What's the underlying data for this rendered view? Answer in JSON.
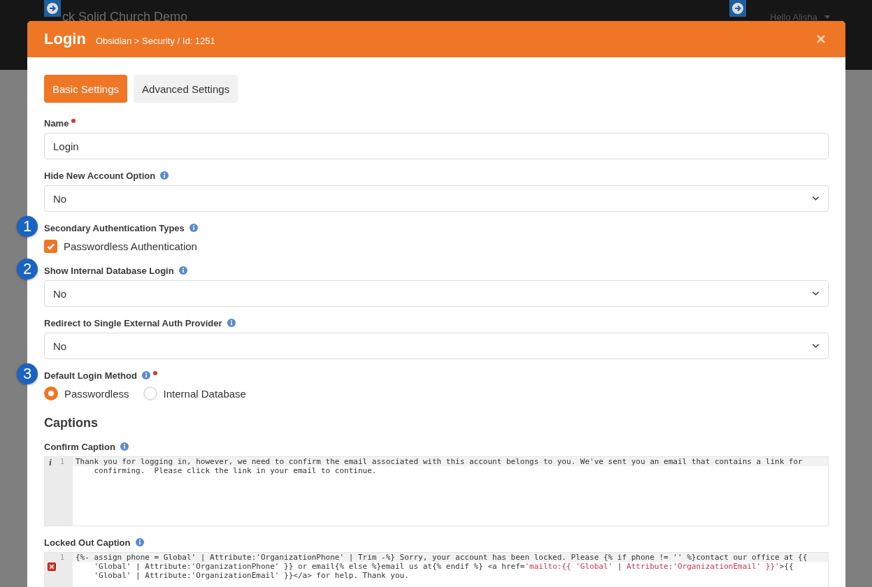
{
  "background": {
    "site_title": "ck Solid Church Demo",
    "user_menu": "Hello Alisha"
  },
  "modal": {
    "title": "Login",
    "breadcrumb": "Obsidian > Security / Id: 1251",
    "close": "×"
  },
  "tabs": [
    {
      "label": "Basic Settings",
      "selected": true
    },
    {
      "label": "Advanced Settings",
      "selected": false
    }
  ],
  "fields": [
    {
      "kind": "text",
      "label": "Name",
      "required": true,
      "info": false,
      "value": "Login"
    },
    {
      "kind": "select",
      "label": "Hide New Account Option",
      "required": false,
      "info": true,
      "value": "No"
    },
    {
      "kind": "checkboxes",
      "label": "Secondary Authentication Types",
      "required": false,
      "info": true,
      "callout": "1",
      "options": [
        {
          "label": "Passwordless Authentication",
          "checked": true
        }
      ]
    },
    {
      "kind": "select",
      "label": "Show Internal Database Login",
      "required": false,
      "info": true,
      "callout": "2",
      "value": "No"
    },
    {
      "kind": "select",
      "label": "Redirect to Single External Auth Provider",
      "required": false,
      "info": true,
      "value": "No"
    },
    {
      "kind": "radios",
      "label": "Default Login Method",
      "required": true,
      "info": true,
      "callout": "3",
      "options": [
        {
          "label": "Passwordless",
          "selected": true
        },
        {
          "label": "Internal Database",
          "selected": false
        }
      ]
    }
  ],
  "section_title": "Captions",
  "editors": [
    {
      "label": "Confirm Caption",
      "info": true,
      "marker": {
        "kind": "info",
        "text": "i"
      },
      "line_number": "1",
      "rows": [
        [
          {
            "kind": "plain",
            "text": "Thank you for logging in, however, we need to confirm the email associated with this account belongs to you. We've sent you an email that contains a link for"
          }
        ],
        [
          {
            "kind": "plain",
            "text": "    confirming.  Please click the link in your email to continue."
          }
        ]
      ]
    },
    {
      "label": "Locked Out Caption",
      "info": true,
      "marker": {
        "kind": "error"
      },
      "line_number": "1",
      "rows": [
        [
          {
            "kind": "plain",
            "text": "{%- assign phone = Global' | Attribute:'OrganizationPhone' | Trim -%} Sorry, your account has been locked. Please {% if phone != '' %}contact our office at {{"
          }
        ],
        [
          {
            "kind": "plain",
            "text": "    'Global' | Attribute:'OrganizationPhone' }} or email{% else %}email us at{% endif %} <a href="
          },
          {
            "kind": "string",
            "text": "'mailto:{{ 'Global'"
          },
          {
            "kind": "plain",
            "text": " | "
          },
          {
            "kind": "string",
            "text": "Attribute:'OrganizationEmail' }}'"
          },
          {
            "kind": "plain",
            "text": ">{{"
          }
        ],
        [
          {
            "kind": "plain",
            "text": "    'Global' | Attribute:'OrganizationEmail' }}</a> for help. Thank you."
          }
        ]
      ]
    }
  ]
}
